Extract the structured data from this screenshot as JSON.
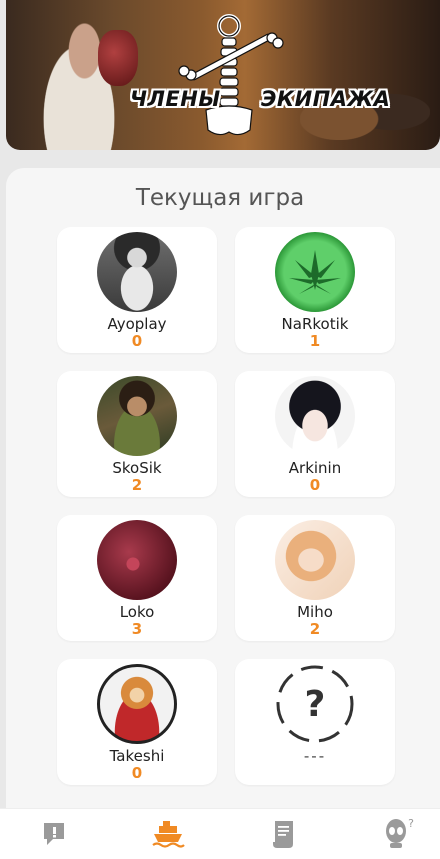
{
  "banner": {
    "logo_left": "ЧЛЕНЫ",
    "logo_right": "ЭКИПАЖА"
  },
  "section_title": "Текущая игра",
  "players": [
    {
      "name": "Ayoplay",
      "score": "0",
      "avatar": "bearded-man-avatar"
    },
    {
      "name": "NaRkotik",
      "score": "1",
      "avatar": "green-leaf-avatar"
    },
    {
      "name": "SkoSik",
      "score": "2",
      "avatar": "fantasy-warrior-avatar"
    },
    {
      "name": "Arkinin",
      "score": "0",
      "avatar": "anime-boy-avatar"
    },
    {
      "name": "Loko",
      "score": "3",
      "avatar": "red-figure-avatar"
    },
    {
      "name": "Miho",
      "score": "2",
      "avatar": "anime-angel-avatar"
    },
    {
      "name": "Takeshi",
      "score": "0",
      "avatar": "shiba-samurai-avatar"
    },
    {
      "name": "---",
      "score": "",
      "avatar": "question-mark-placeholder"
    }
  ],
  "nav": {
    "items": [
      "chat-icon",
      "ship-icon",
      "scroll-icon",
      "alien-help-icon"
    ],
    "active": 1,
    "accent": "#f08a24"
  }
}
